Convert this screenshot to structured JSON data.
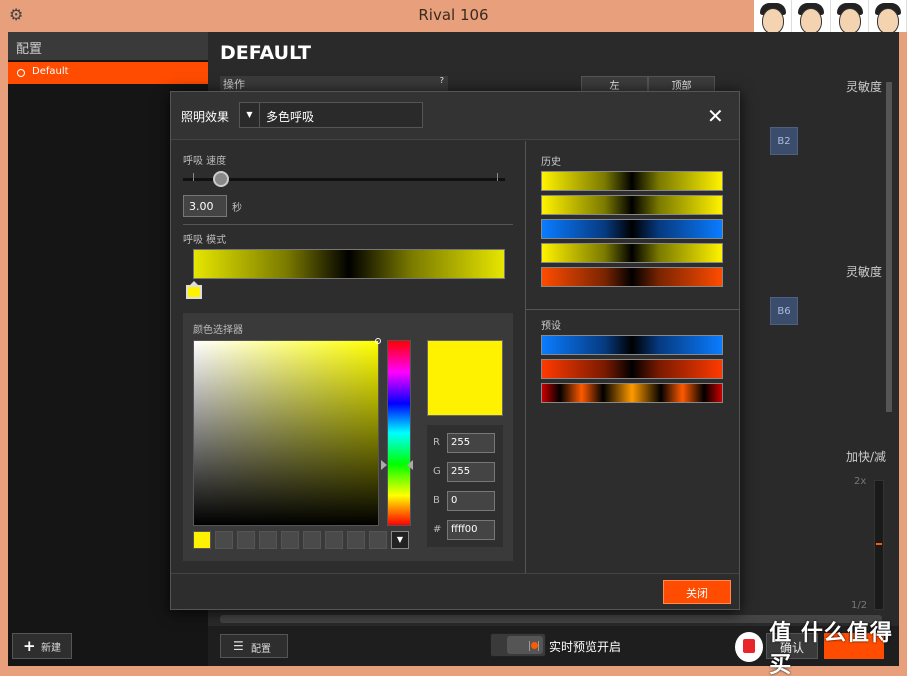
{
  "window": {
    "title": "Rival 106"
  },
  "sidebar": {
    "header": "配置",
    "items": [
      {
        "label": "Default"
      }
    ],
    "new_button": "新建"
  },
  "main": {
    "heading": "DEFAULT",
    "operation_label": "操作",
    "help": "?",
    "tabs": [
      "左",
      "顶部"
    ],
    "pills": [
      "B2",
      "B6"
    ],
    "right_labels": [
      "灵敏度",
      "灵敏度",
      "加快/减"
    ],
    "meter_top": "2x",
    "meter_bottom": "1/2",
    "config_button": "配置",
    "live_preview": "实时预览开启",
    "apply_button": "确认"
  },
  "dialog": {
    "effect_label": "照明效果",
    "effect_value": "多色呼吸",
    "close_icon": "✕",
    "speed_label": "呼吸 速度",
    "speed_value": "3.00",
    "speed_unit": "秒",
    "pattern_label": "呼吸 模式",
    "picker_label": "颜色选择器",
    "rgb": {
      "r_label": "R",
      "r": "255",
      "g_label": "G",
      "g": "255",
      "b_label": "B",
      "b": "0",
      "hex_label": "#",
      "hex": "ffff00"
    },
    "history_label": "历史",
    "presets_label": "预设",
    "close_button": "关闭"
  },
  "colors": {
    "accent": "#ff4c00",
    "selected": "#fff200",
    "title_bar": "#e8a07c"
  },
  "watermark": {
    "text": "值 什么值得买"
  }
}
